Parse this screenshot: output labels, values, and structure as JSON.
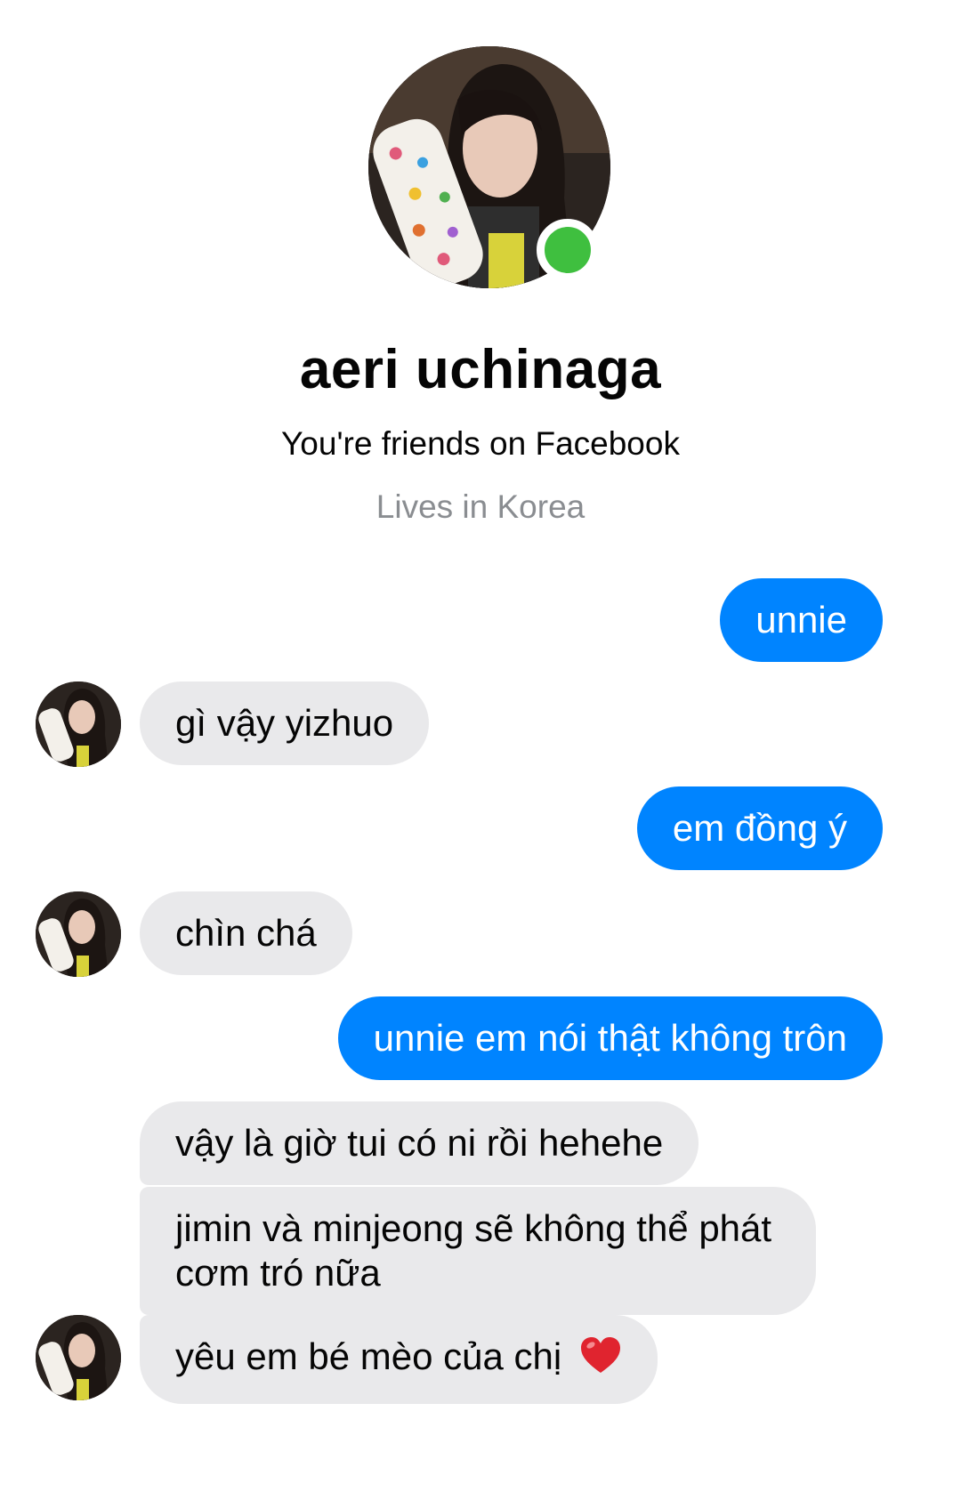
{
  "contact": {
    "name": "aeri uchinaga",
    "friends_status": "You're friends on Facebook",
    "location": "Lives in Korea",
    "online": true,
    "online_color": "#3fbf3f"
  },
  "colors": {
    "outgoing_bubble": "#0084ff",
    "incoming_bubble": "#e9e9eb",
    "secondary_text": "#8a8d91"
  },
  "messages": [
    {
      "from": "me",
      "text": "unnie"
    },
    {
      "from": "them",
      "text": "gì vậy yizhuo"
    },
    {
      "from": "me",
      "text": "em đồng ý"
    },
    {
      "from": "them",
      "text": "chìn chá"
    },
    {
      "from": "me",
      "text": "unnie em nói thật không trôn"
    },
    {
      "from": "them",
      "text": "vậy là giờ tui có ni rồi hehehe"
    },
    {
      "from": "them",
      "text": "jimin và minjeong sẽ không thể phát cơm tró nữa"
    },
    {
      "from": "them",
      "text": "yêu em bé mèo của chị",
      "emoji": "heart-emoji"
    }
  ]
}
